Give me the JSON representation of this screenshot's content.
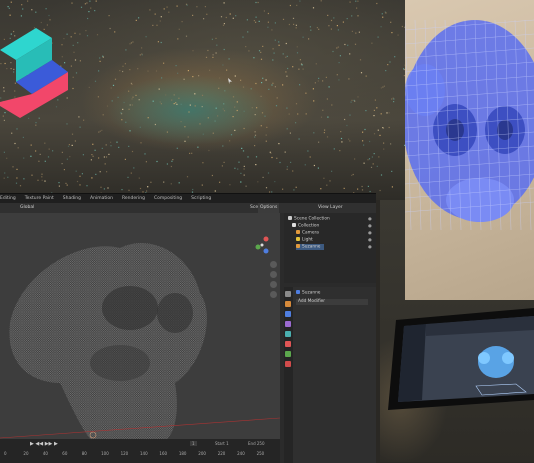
{
  "blender": {
    "menu": [
      "Editing",
      "Texture Paint",
      "Shading",
      "Animation",
      "Rendering",
      "Compositing",
      "Scripting"
    ],
    "toolbar": {
      "mode": "Global",
      "options": "Options",
      "scene_label": "Scene",
      "view_layer_label": "View Layer"
    },
    "outliner": {
      "items": [
        "Scene Collection",
        "Collection",
        "Camera",
        "Light",
        "Suzanne"
      ]
    },
    "properties": {
      "object_name": "Suzanne",
      "add_modifier": "Add Modifier"
    },
    "timeline": {
      "current_frame": "1",
      "start_label": "Start",
      "start_value": "1",
      "end_label": "End",
      "end_value": "250",
      "ticks": [
        "0",
        "20",
        "40",
        "60",
        "80",
        "100",
        "120",
        "140",
        "160",
        "180",
        "200",
        "220",
        "240",
        "250"
      ]
    }
  },
  "colors": {
    "logo_cyan": "#2ed6cf",
    "logo_blue": "#3b5bd9",
    "logo_pink": "#f2476a",
    "mesh_blue": "#5a6ef0",
    "blender_bg": "#2b2b2b"
  }
}
